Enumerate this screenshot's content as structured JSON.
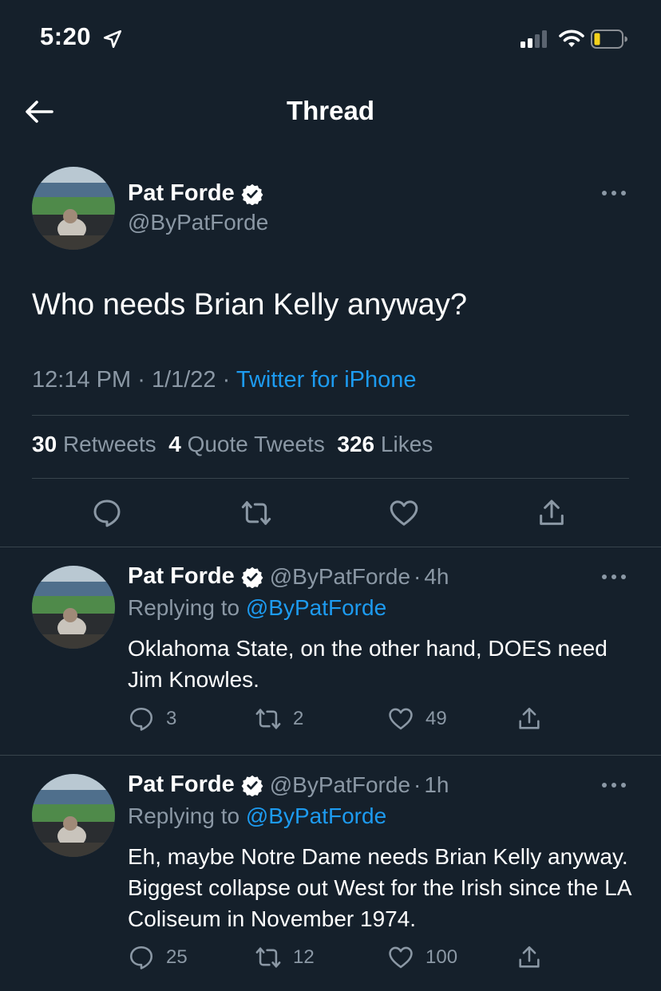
{
  "status_bar": {
    "time": "5:20",
    "icons": [
      "location-arrow-icon",
      "signal-icon",
      "wifi-icon",
      "battery-icon"
    ]
  },
  "header": {
    "title": "Thread",
    "back_icon": "back-arrow-icon"
  },
  "main_tweet": {
    "author_name": "Pat Forde",
    "author_handle": "@ByPatForde",
    "text": "Who needs Brian Kelly anyway?",
    "time": "12:14 PM",
    "date": "1/1/22",
    "source": "Twitter for iPhone",
    "sep": "·",
    "stats": {
      "retweets_count": "30",
      "retweets_label": "Retweets",
      "quotes_count": "4",
      "quotes_label": "Quote Tweets",
      "likes_count": "326",
      "likes_label": "Likes"
    }
  },
  "replies": [
    {
      "author_name": "Pat Forde",
      "author_handle": "@ByPatForde",
      "time": "4h",
      "replying_label": "Replying to",
      "replying_to": "@ByPatForde",
      "text": "Oklahoma State, on the other hand, DOES need Jim Knowles.",
      "reply_count": "3",
      "retweet_count": "2",
      "like_count": "49"
    },
    {
      "author_name": "Pat Forde",
      "author_handle": "@ByPatForde",
      "time": "1h",
      "replying_label": "Replying to",
      "replying_to": "@ByPatForde",
      "text": "Eh, maybe Notre Dame needs Brian Kelly anyway. Biggest collapse out West for the Irish since the LA Coliseum in November 1974.",
      "reply_count": "25",
      "retweet_count": "12",
      "like_count": "100"
    }
  ],
  "colors": {
    "background": "#15202b",
    "accent": "#1d9bf0",
    "secondary_text": "#8b98a5",
    "divider": "#38444d"
  }
}
